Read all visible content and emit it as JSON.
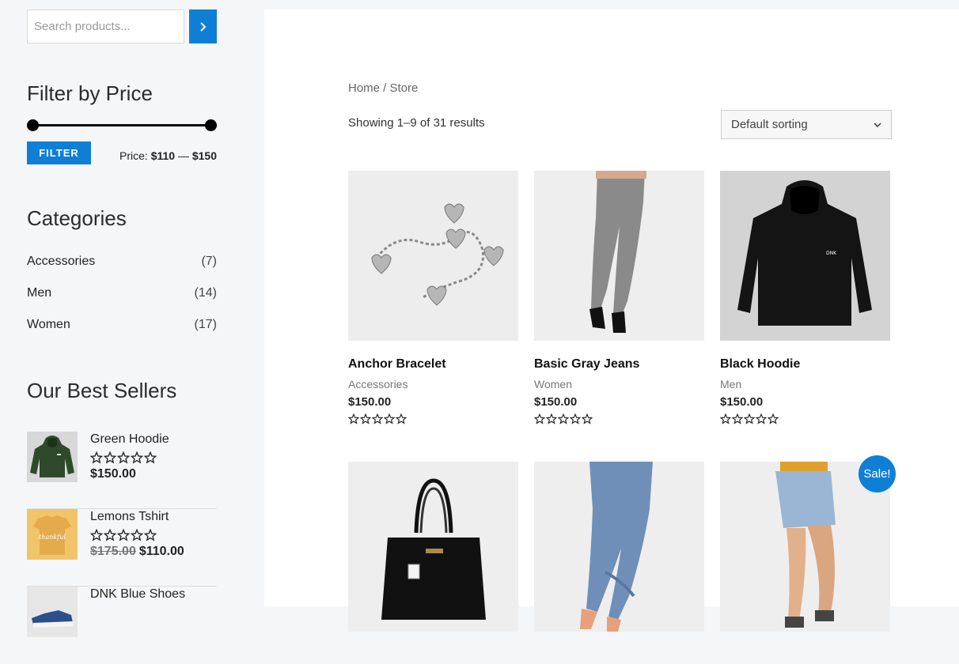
{
  "search": {
    "placeholder": "Search products..."
  },
  "price_filter": {
    "title": "Filter by Price",
    "button": "FILTER",
    "label": "Price:",
    "min": "$110",
    "sep": "—",
    "max": "$150"
  },
  "categories": {
    "title": "Categories",
    "items": [
      {
        "name": "Accessories",
        "count": "(7)"
      },
      {
        "name": "Men",
        "count": "(14)"
      },
      {
        "name": "Women",
        "count": "(17)"
      }
    ]
  },
  "best_sellers": {
    "title": "Our Best Sellers",
    "items": [
      {
        "name": "Green Hoodie",
        "price": "$150.00",
        "old_price": ""
      },
      {
        "name": "Lemons Tshirt",
        "price": "$110.00",
        "old_price": "$175.00"
      },
      {
        "name": "DNK Blue Shoes",
        "price": "",
        "old_price": ""
      }
    ]
  },
  "breadcrumb": "Home / Store",
  "results": "Showing 1–9 of 31 results",
  "sort": {
    "selected": "Default sorting"
  },
  "products": [
    {
      "name": "Anchor Bracelet",
      "category": "Accessories",
      "price": "$150.00"
    },
    {
      "name": "Basic Gray Jeans",
      "category": "Women",
      "price": "$150.00"
    },
    {
      "name": "Black Hoodie",
      "category": "Men",
      "price": "$150.00"
    },
    {
      "name": "",
      "category": "",
      "price": ""
    },
    {
      "name": "",
      "category": "",
      "price": ""
    },
    {
      "name": "",
      "category": "",
      "price": ""
    }
  ],
  "sale_badge": "Sale!",
  "colors": {
    "accent": "#0f7fd6"
  },
  "icons": {
    "search_button": "chevron-right-icon",
    "rating": "star-outline-icon"
  }
}
